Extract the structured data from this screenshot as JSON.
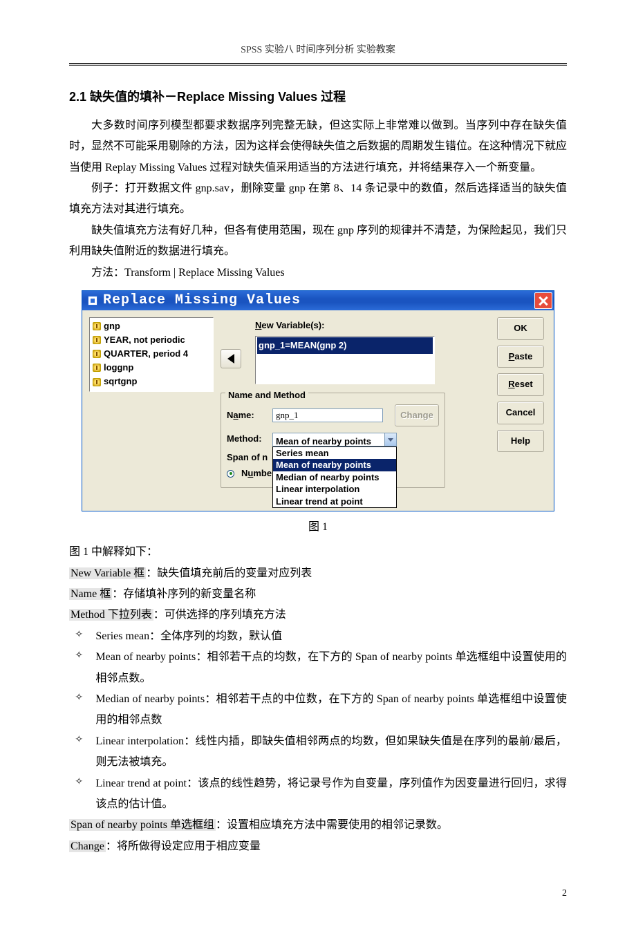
{
  "header": "SPSS 实验八 时间序列分析 实验教案",
  "section_title": "2.1 缺失值的填补－Replace Missing Values 过程",
  "paragraphs": [
    "大多数时间序列模型都要求数据序列完整无缺，但这实际上非常难以做到。当序列中存在缺失值时，显然不可能采用剔除的方法，因为这样会使得缺失值之后数据的周期发生错位。在这种情况下就应当使用 Replay Missing Values 过程对缺失值采用适当的方法进行填充，并将结果存入一个新变量。",
    "例子：打开数据文件 gnp.sav，删除变量 gnp 在第 8、14 条记录中的数值，然后选择适当的缺失值填充方法对其进行填充。",
    "缺失值填充方法有好几种，但各有使用范围，现在 gnp 序列的规律并不清楚，为保险起见，我们只利用缺失值附近的数据进行填充。",
    "方法：Transform | Replace Missing Values"
  ],
  "dialog": {
    "title": "Replace Missing Values",
    "vars": [
      "gnp",
      "YEAR, not periodic",
      "QUARTER, period 4",
      "loggnp",
      "sqrtgnp"
    ],
    "new_var_label": "New Variable(s):",
    "new_var_row": "gnp_1=MEAN(gnp 2)",
    "fieldset_title": "Name and Method",
    "name_label": "Name:",
    "name_value": "gnp_1",
    "change_label": "Change",
    "method_label": "Method:",
    "method_value": "Mean of nearby points",
    "method_options": [
      "Series mean",
      "Mean of nearby points",
      "Median of nearby points",
      "Linear interpolation",
      "Linear trend at point"
    ],
    "span_label": "Span of n",
    "number_label": "Numbe",
    "buttons": {
      "ok": "OK",
      "paste": "Paste",
      "reset": "Reset",
      "cancel": "Cancel",
      "help": "Help"
    }
  },
  "fig_caption": "图 1",
  "explain": {
    "intro": "图 1 中解释如下：",
    "lines": [
      {
        "hl": "New Variable 框",
        "rest": "：缺失值填充前后的变量对应列表"
      },
      {
        "hl": "Name 框",
        "rest": "：存储填补序列的新变量名称"
      },
      {
        "hl": "Method 下拉列表",
        "rest": "：可供选择的序列填充方法"
      }
    ],
    "bullets": [
      "Series mean：全体序列的均数，默认值",
      "Mean of nearby points：相邻若干点的均数，在下方的 Span of nearby points 单选框组中设置使用的相邻点数。",
      "Median of nearby points：相邻若干点的中位数，在下方的 Span of nearby points 单选框组中设置使用的相邻点数",
      "Linear interpolation：线性内插，即缺失值相邻两点的均数，但如果缺失值是在序列的最前/最后，则无法被填充。",
      "Linear trend at point：该点的线性趋势，将记录号作为自变量，序列值作为因变量进行回归，求得该点的估计值。"
    ],
    "tail": [
      {
        "hl": "Span of nearby points 单选框组",
        "rest": "：设置相应填充方法中需要使用的相邻记录数。"
      },
      {
        "hl": "Change",
        "rest": "：将所做得设定应用于相应变量"
      }
    ]
  },
  "page_number": "2"
}
